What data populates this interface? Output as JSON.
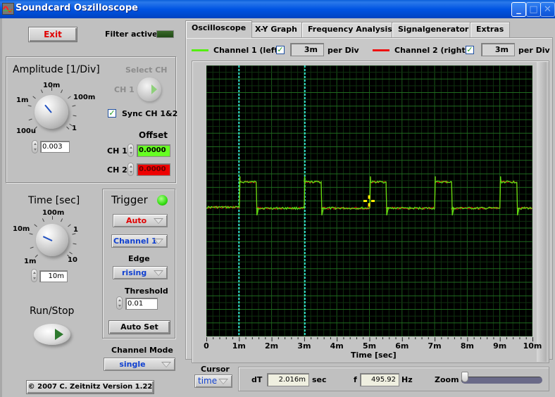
{
  "window": {
    "title": "Soundcard Oszilloscope",
    "buttons": {
      "minimize": "_",
      "maximize": "□",
      "close": "✕"
    }
  },
  "left": {
    "exit_label": "Exit",
    "filter_label": "Filter active",
    "filter_on": false,
    "amplitude": {
      "title": "Amplitude [1/Div]",
      "scale_labels": [
        "100u",
        "1m",
        "10m",
        "100m",
        "1"
      ],
      "value": "0.003"
    },
    "select_ch": {
      "title": "Select CH",
      "value": "CH 1"
    },
    "sync_label": "Sync CH 1&2",
    "sync_checked": true,
    "offset": {
      "title": "Offset",
      "ch1_label": "CH 1",
      "ch1_value": "0.0000",
      "ch2_label": "CH 2",
      "ch2_value": "0.0000"
    },
    "time": {
      "title": "Time [sec]",
      "scale_labels": [
        "1m",
        "10m",
        "100m",
        "1",
        "10"
      ],
      "value": "10m"
    },
    "trigger": {
      "title": "Trigger",
      "led_color": "#33dd11",
      "mode": "Auto",
      "source": "Channel 1",
      "edge_label": "Edge",
      "edge": "rising",
      "threshold_label": "Threshold",
      "threshold": "0.01",
      "autoset_label": "Auto Set"
    },
    "runstop_label": "Run/Stop",
    "channel_mode": {
      "label": "Channel Mode",
      "value": "single"
    },
    "copyright": "© 2007  C. Zeitnitz Version 1.22"
  },
  "tabs": [
    {
      "label": "Oscilloscope",
      "active": true
    },
    {
      "label": "X-Y Graph",
      "active": false
    },
    {
      "label": "Frequency Analysis",
      "active": false
    },
    {
      "label": "Signalgenerator",
      "active": false
    },
    {
      "label": "Extras",
      "active": false
    }
  ],
  "channels": [
    {
      "label": "Channel 1 (left)",
      "color": "#55ee11",
      "enabled": true,
      "per_div": "3m",
      "per_div_label": "per Div"
    },
    {
      "label": "Channel 2 (right)",
      "color": "#ee1111",
      "enabled": true,
      "per_div": "3m",
      "per_div_label": "per Div"
    }
  ],
  "cursor": {
    "label": "Cursor",
    "mode": "time",
    "dt_label": "dT",
    "dt_value": "2.016m",
    "dt_unit": "sec",
    "f_label": "f",
    "f_value": "495.92",
    "f_unit": "Hz",
    "zoom_label": "Zoom",
    "zoom_value": 0
  },
  "chart_data": {
    "type": "line",
    "title": "",
    "xlabel": "Time [sec]",
    "ylabel": "",
    "xlim": [
      0,
      0.01
    ],
    "ylim": [
      -0.015,
      0.015
    ],
    "x_ticks": [
      "0",
      "1m",
      "2m",
      "3m",
      "4m",
      "5m",
      "6m",
      "7m",
      "8m",
      "9m",
      "10m"
    ],
    "grid": true,
    "cursors_x": [
      0.001,
      0.00302
    ],
    "cursor_color": "#33e0d0",
    "marker": {
      "x": 0.00499,
      "y": 0.0,
      "color": "#ffee00"
    },
    "series": [
      {
        "name": "Channel 1 (left)",
        "color": "#55ee11",
        "waveform": "square",
        "low": -0.0008,
        "high": 0.0021,
        "pre_level": -0.0007,
        "rising_edges": [
          0.00101,
          0.003,
          0.00501,
          0.007,
          0.009
        ],
        "falling_edges": [
          0.00153,
          0.00352,
          0.00551,
          0.00752,
          0.00952
        ]
      },
      {
        "name": "Channel 2 (right)",
        "color": "#ee1111",
        "waveform": "square",
        "low": -0.0008,
        "high": 0.0021,
        "pre_level": -0.0007,
        "rising_edges": [
          0.00101,
          0.003,
          0.00501,
          0.007,
          0.009
        ],
        "falling_edges": [
          0.00153,
          0.00352,
          0.00551,
          0.00752,
          0.00952
        ]
      }
    ]
  }
}
